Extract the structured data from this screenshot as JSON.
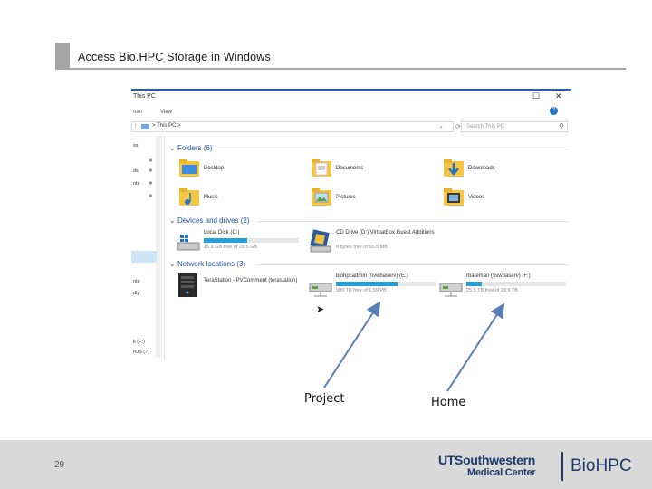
{
  "slide": {
    "title": "Access Bio.HPC Storage in Windows",
    "page_number": "29"
  },
  "explorer": {
    "window_title": "This PC",
    "maximize_glyph": "☐",
    "close_glyph": "✕",
    "ribbon": {
      "tab_left": "nter",
      "tab_view": "View",
      "help_glyph": "?"
    },
    "address": {
      "path": "> This PC >"
    },
    "search": {
      "placeholder": "Search This PC"
    },
    "nav_items": [
      {
        "label": "ss",
        "pin": ""
      },
      {
        "label": "",
        "pin": "✱"
      },
      {
        "label": "ds",
        "pin": "✱"
      },
      {
        "label": "nts",
        "pin": "✱"
      },
      {
        "label": "",
        "pin": "✱"
      },
      {
        "label": "nts",
        "pin": ""
      },
      {
        "label": "dly",
        "pin": ""
      },
      {
        "label": "k (F:)",
        "pin": ""
      },
      {
        "label": "rOS (?)",
        "pin": ""
      }
    ],
    "sections": {
      "folders": "Folders (6)",
      "devices": "Devices and drives (2)",
      "network": "Network locations (3)"
    },
    "folders": [
      {
        "name": "Desktop",
        "icon": "desktop-folder-icon"
      },
      {
        "name": "Documents",
        "icon": "documents-folder-icon"
      },
      {
        "name": "Downloads",
        "icon": "downloads-folder-icon"
      },
      {
        "name": "Music",
        "icon": "music-folder-icon"
      },
      {
        "name": "Pictures",
        "icon": "pictures-folder-icon"
      },
      {
        "name": "Videos",
        "icon": "videos-folder-icon"
      }
    ],
    "drives": [
      {
        "name": "Local Disk (C:)",
        "free": "15.9 GB free of 29.5 GB",
        "used_fraction": 0.46,
        "icon": "local-disk-icon"
      },
      {
        "name": "CD Drive (D:) VirtualBox Guest Additions",
        "free": "0 bytes free of 55.5 MB",
        "icon": "cd-drive-icon"
      }
    ],
    "network_locations": [
      {
        "name": "TeraStation - PVComment (terastation)",
        "icon": "nas-icon"
      },
      {
        "name": "biohpcadmin (\\\\vwbaserv) (E:)",
        "free": "999 TB free of 1.59 PB",
        "used_fraction": 0.62,
        "icon": "network-drive-icon"
      },
      {
        "name": "rbateman (\\\\vwbaserv) (F:)",
        "free": "25.5 TB free of 29.9 TB",
        "used_fraction": 0.15,
        "icon": "network-drive-icon"
      }
    ]
  },
  "annotations": {
    "project": "Project",
    "home": "Home"
  },
  "footer": {
    "logo_line1": "UTSouthwestern",
    "logo_line2": "Medical Center",
    "logo_brand": "BioHPC"
  },
  "colors": {
    "accent_gray": "#a6a6a6",
    "drive_bar": "#26a0da",
    "logo_navy": "#1b3a6b",
    "arrow_blue": "#5b7fb5"
  }
}
